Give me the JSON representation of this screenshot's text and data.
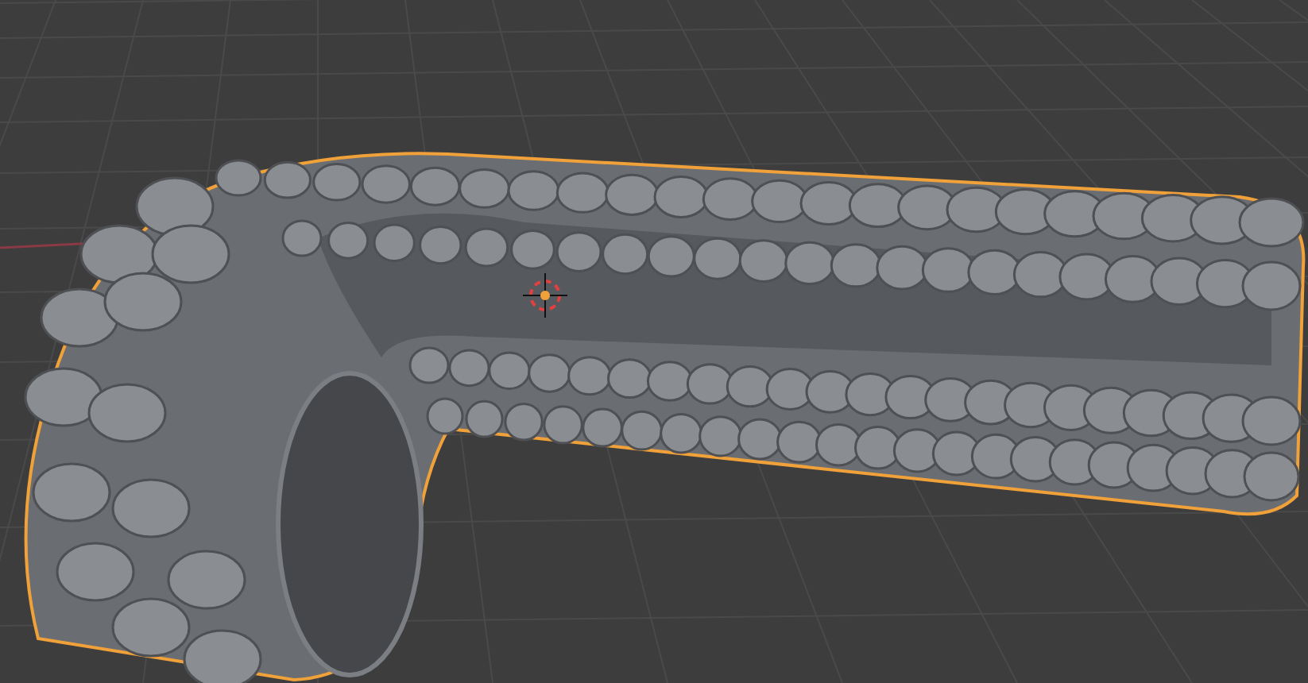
{
  "viewport": {
    "grid": true,
    "object": {
      "selected": true
    },
    "cursor": true
  }
}
